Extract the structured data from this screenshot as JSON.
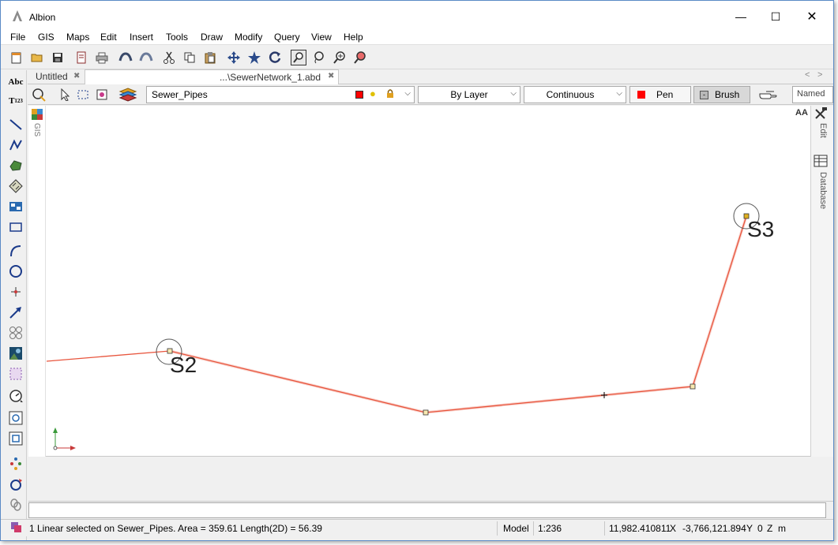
{
  "window": {
    "title": "Albion",
    "minimize_glyph": "—",
    "maximize_glyph": "☐",
    "close_glyph": "✕"
  },
  "menu": [
    "File",
    "GIS",
    "Maps",
    "Edit",
    "Insert",
    "Tools",
    "Draw",
    "Modify",
    "Query",
    "View",
    "Help"
  ],
  "toolbar_icons": [
    "new-file-icon",
    "open-folder-icon",
    "save-icon",
    "page-setup-icon",
    "print-icon",
    "undo-icon",
    "redo-icon",
    "cut-icon",
    "copy-icon",
    "paste-icon",
    "pan-icon",
    "zoom-extents-icon",
    "refresh-icon",
    "zoom-window-icon",
    "zoom-lasso-icon",
    "zoom-in-out-icon",
    "zoom-previous-icon"
  ],
  "tabs": {
    "untitled": "Untitled",
    "document": "...\\SewerNetwork_1.abd",
    "close_glyph": "✖",
    "prev_glyph": "<",
    "next_glyph": ">"
  },
  "layer_toolbar": {
    "layer_name": "Sewer_Pipes",
    "color_mode": "By Layer",
    "line_style": "Continuous",
    "pen_label": "Pen",
    "brush_label": "Brush",
    "brush_minus": "-",
    "named_label": "Named",
    "dropdown_glyph": "⌵",
    "layer_color": "#ff0000",
    "pen_color": "#ff0000"
  },
  "side_panels": {
    "gis": "GIS",
    "edit": "Edit",
    "database": "Database",
    "text_size": "AA"
  },
  "drawing": {
    "points": [
      {
        "label": "S2"
      },
      {
        "label": "S3"
      }
    ],
    "line_color": "#e8553d"
  },
  "status": {
    "selection": "1 Linear selected on Sewer_Pipes.   Area = 359.61   Length(2D) = 56.39",
    "space": "Model",
    "scale": "1:236",
    "x_value": "11,982.410811",
    "x_label": "X",
    "y_value": "-3,766,121.894",
    "y_label": "Y",
    "z_value": "0",
    "z_label": "Z",
    "unit": "m"
  }
}
